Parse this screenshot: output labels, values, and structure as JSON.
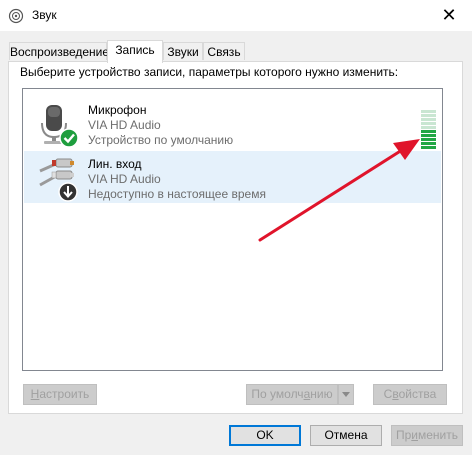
{
  "window": {
    "title": "Звук",
    "icon": "speaker-icon",
    "close_glyph": "✕"
  },
  "tabs": [
    {
      "label": "Воспроизведение",
      "active": false
    },
    {
      "label": "Запись",
      "active": true
    },
    {
      "label": "Звуки",
      "active": false
    },
    {
      "label": "Связь",
      "active": false
    }
  ],
  "panel": {
    "instruction": "Выберите устройство записи, параметры которого нужно изменить:"
  },
  "devices": [
    {
      "name": "Микрофон",
      "driver": "VIA HD Audio",
      "status": "Устройство по умолчанию",
      "icon": "microphone-icon",
      "badge": "default-check-icon",
      "level_segments_total": 10,
      "level_segments_lit": 5
    },
    {
      "name": "Лин. вход",
      "driver": "VIA HD Audio",
      "status": "Недоступно в настоящее время",
      "icon": "line-in-cable-icon",
      "badge": "down-arrow-icon",
      "selected": true
    }
  ],
  "list_buttons": {
    "configure": {
      "label": "Настроить",
      "accel": "Н",
      "rest": "астроить"
    },
    "set_default": {
      "label": "По умолчанию",
      "pre": "По умолч",
      "accel": "а",
      "post": "нию"
    },
    "properties": {
      "label": "Свойства",
      "pre": "С",
      "accel": "в",
      "post": "ойства"
    }
  },
  "dialog_buttons": {
    "ok": "OK",
    "cancel": "Отмена",
    "apply": {
      "label": "Применить",
      "pre": "Пр",
      "accel": "и",
      "post": "менить"
    }
  },
  "colors": {
    "accent": "#0078d7",
    "check_green": "#1e9e3e",
    "level_on": "#22a745",
    "level_off": "#c9e6d2",
    "annotation_arrow": "#e0142b",
    "selected_row": "#e5f1fb"
  }
}
